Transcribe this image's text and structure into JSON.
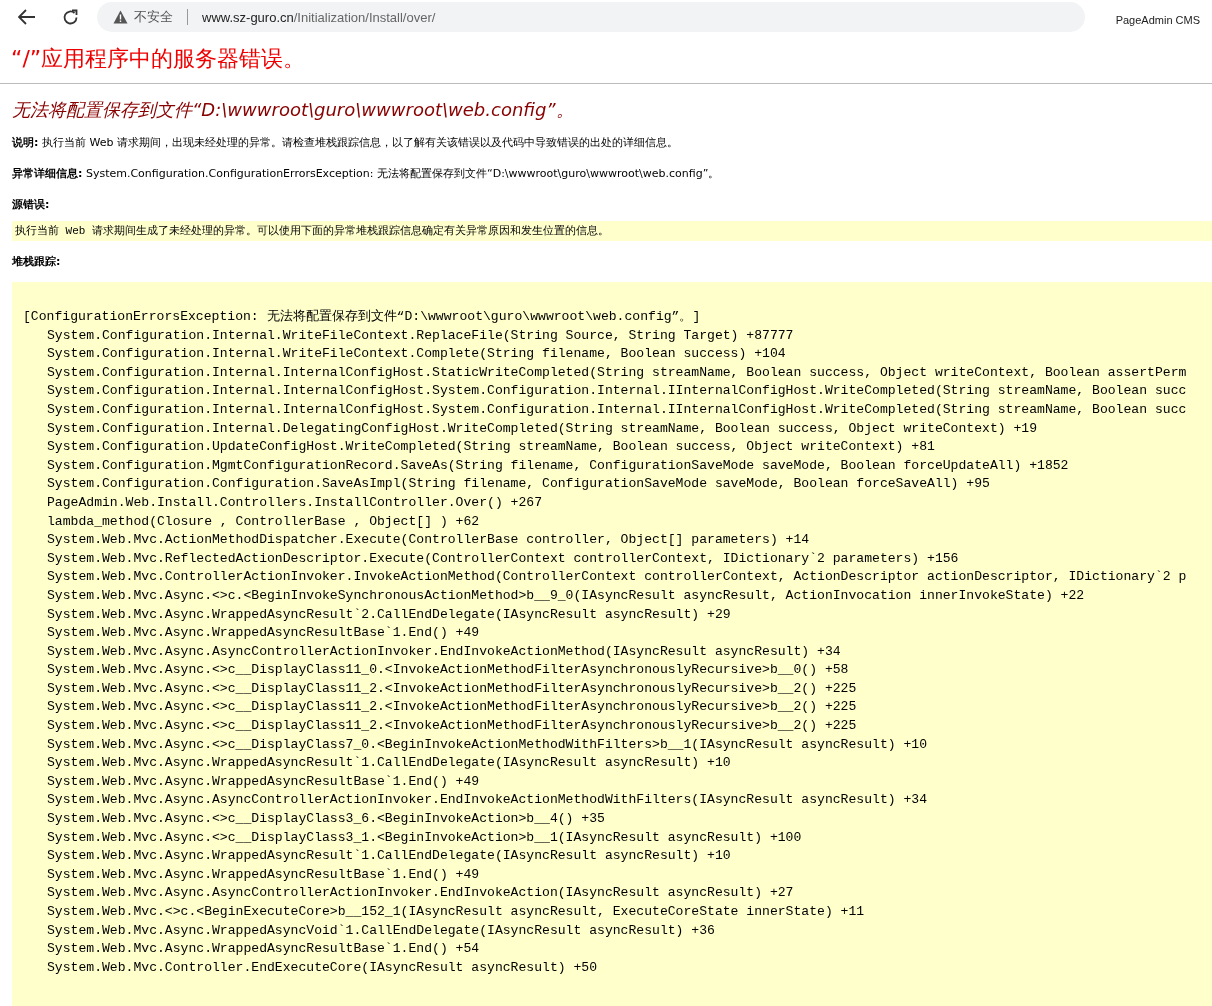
{
  "browser": {
    "security_label": "不安全",
    "url_host": "www.sz-guro.cn",
    "url_path": "/Initialization/Install/over/",
    "extension_label": "PageAdmin CMS"
  },
  "page": {
    "title": "“/”应用程序中的服务器错误。",
    "subtitle": "无法将配置保存到文件“D:\\wwwroot\\guro\\wwwroot\\web.config”。",
    "description": {
      "label": "说明:",
      "text": "执行当前 Web 请求期间，出现未经处理的异常。请检查堆栈跟踪信息，以了解有关该错误以及代码中导致错误的出处的详细信息。"
    },
    "exception_details": {
      "label": "异常详细信息:",
      "text": "System.Configuration.ConfigurationErrorsException: 无法将配置保存到文件“D:\\wwwroot\\guro\\wwwroot\\web.config”。"
    },
    "source_error": {
      "label": "源错误:",
      "text": "执行当前 Web 请求期间生成了未经处理的异常。可以使用下面的异常堆栈跟踪信息确定有关异常原因和发生位置的信息。"
    },
    "stack_trace": {
      "label": "堆栈跟踪:",
      "header": "[ConfigurationErrorsException: 无法将配置保存到文件“D:\\wwwroot\\guro\\wwwroot\\web.config”。]",
      "frames": [
        "System.Configuration.Internal.WriteFileContext.ReplaceFile(String Source, String Target) +87777",
        "System.Configuration.Internal.WriteFileContext.Complete(String filename, Boolean success) +104",
        "System.Configuration.Internal.InternalConfigHost.StaticWriteCompleted(String streamName, Boolean success, Object writeContext, Boolean assertPerm",
        "System.Configuration.Internal.InternalConfigHost.System.Configuration.Internal.IInternalConfigHost.WriteCompleted(String streamName, Boolean succ",
        "System.Configuration.Internal.InternalConfigHost.System.Configuration.Internal.IInternalConfigHost.WriteCompleted(String streamName, Boolean succ",
        "System.Configuration.Internal.DelegatingConfigHost.WriteCompleted(String streamName, Boolean success, Object writeContext) +19",
        "System.Configuration.UpdateConfigHost.WriteCompleted(String streamName, Boolean success, Object writeContext) +81",
        "System.Configuration.MgmtConfigurationRecord.SaveAs(String filename, ConfigurationSaveMode saveMode, Boolean forceUpdateAll) +1852",
        "System.Configuration.Configuration.SaveAsImpl(String filename, ConfigurationSaveMode saveMode, Boolean forceSaveAll) +95",
        "PageAdmin.Web.Install.Controllers.InstallController.Over() +267",
        "lambda_method(Closure , ControllerBase , Object[] ) +62",
        "System.Web.Mvc.ActionMethodDispatcher.Execute(ControllerBase controller, Object[] parameters) +14",
        "System.Web.Mvc.ReflectedActionDescriptor.Execute(ControllerContext controllerContext, IDictionary`2 parameters) +156",
        "System.Web.Mvc.ControllerActionInvoker.InvokeActionMethod(ControllerContext controllerContext, ActionDescriptor actionDescriptor, IDictionary`2 p",
        "System.Web.Mvc.Async.<>c.<BeginInvokeSynchronousActionMethod>b__9_0(IAsyncResult asyncResult, ActionInvocation innerInvokeState) +22",
        "System.Web.Mvc.Async.WrappedAsyncResult`2.CallEndDelegate(IAsyncResult asyncResult) +29",
        "System.Web.Mvc.Async.WrappedAsyncResultBase`1.End() +49",
        "System.Web.Mvc.Async.AsyncControllerActionInvoker.EndInvokeActionMethod(IAsyncResult asyncResult) +34",
        "System.Web.Mvc.Async.<>c__DisplayClass11_0.<InvokeActionMethodFilterAsynchronouslyRecursive>b__0() +58",
        "System.Web.Mvc.Async.<>c__DisplayClass11_2.<InvokeActionMethodFilterAsynchronouslyRecursive>b__2() +225",
        "System.Web.Mvc.Async.<>c__DisplayClass11_2.<InvokeActionMethodFilterAsynchronouslyRecursive>b__2() +225",
        "System.Web.Mvc.Async.<>c__DisplayClass11_2.<InvokeActionMethodFilterAsynchronouslyRecursive>b__2() +225",
        "System.Web.Mvc.Async.<>c__DisplayClass7_0.<BeginInvokeActionMethodWithFilters>b__1(IAsyncResult asyncResult) +10",
        "System.Web.Mvc.Async.WrappedAsyncResult`1.CallEndDelegate(IAsyncResult asyncResult) +10",
        "System.Web.Mvc.Async.WrappedAsyncResultBase`1.End() +49",
        "System.Web.Mvc.Async.AsyncControllerActionInvoker.EndInvokeActionMethodWithFilters(IAsyncResult asyncResult) +34",
        "System.Web.Mvc.Async.<>c__DisplayClass3_6.<BeginInvokeAction>b__4() +35",
        "System.Web.Mvc.Async.<>c__DisplayClass3_1.<BeginInvokeAction>b__1(IAsyncResult asyncResult) +100",
        "System.Web.Mvc.Async.WrappedAsyncResult`1.CallEndDelegate(IAsyncResult asyncResult) +10",
        "System.Web.Mvc.Async.WrappedAsyncResultBase`1.End() +49",
        "System.Web.Mvc.Async.AsyncControllerActionInvoker.EndInvokeAction(IAsyncResult asyncResult) +27",
        "System.Web.Mvc.<>c.<BeginExecuteCore>b__152_1(IAsyncResult asyncResult, ExecuteCoreState innerState) +11",
        "System.Web.Mvc.Async.WrappedAsyncVoid`1.CallEndDelegate(IAsyncResult asyncResult) +36",
        "System.Web.Mvc.Async.WrappedAsyncResultBase`1.End() +54",
        "System.Web.Mvc.Controller.EndExecuteCore(IAsyncResult asyncResult) +50"
      ]
    }
  }
}
